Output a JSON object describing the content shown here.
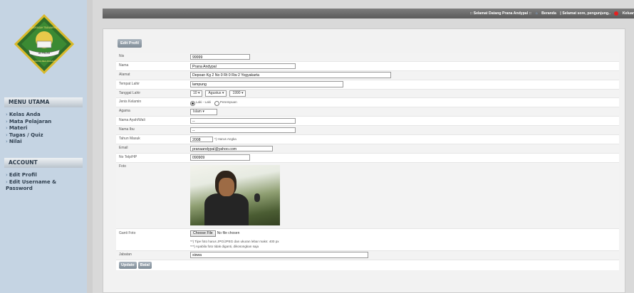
{
  "topbar": {
    "welcome": ":: Selamat Datang Prana Andypal ::",
    "home_label": "Beranda",
    "greeting": "| Selamat sore, pengunjung..",
    "logout_label": "Keluar"
  },
  "logo": {
    "banner_text": "MADRASAH TSANAWIYAH",
    "ribbon_text": "AL-FALAH",
    "bottom_text": "TANJUNG BELUNGKANG"
  },
  "sidebar": {
    "menu_title": "MENU UTAMA",
    "menu_items": [
      "Kelas Anda",
      "Mata Pelajaran",
      "Materi",
      "Tugas / Quiz",
      "Nilai"
    ],
    "account_title": "ACCOUNT",
    "account_items": [
      "Edit Profil",
      "Edit Username & Password"
    ]
  },
  "page": {
    "title": "Edit Profil"
  },
  "form": {
    "nis": {
      "label": "Nis",
      "value": "99999"
    },
    "nama": {
      "label": "Nama",
      "value": "Prana Andypal"
    },
    "alamat": {
      "label": "Alamat",
      "value": "Depoan Kg 2 No 0 Rt 0 Rw 2 Yogyakarta"
    },
    "tempat_lahir": {
      "label": "Tempat Lahir",
      "value": "lampung"
    },
    "tanggal_lahir": {
      "label": "Tanggal Lahir",
      "day": "10",
      "month": "Agustus",
      "year": "1990"
    },
    "jenis_kelamin": {
      "label": "Jenis Kelamin",
      "opt1": "Laki - Laki",
      "opt2": "Perempuan",
      "selected": "Laki - Laki"
    },
    "agama": {
      "label": "Agama",
      "value": "Islam"
    },
    "nama_ayah": {
      "label": "Nama Ayah/Wali",
      "value": "--"
    },
    "nama_ibu": {
      "label": "Nama Ibu",
      "value": "--"
    },
    "tahun_masuk": {
      "label": "Tahun Masuk",
      "value": "2008",
      "hint": "*) Harus Angka"
    },
    "email": {
      "label": "Email",
      "value": "pranaandypal@yahoo.com"
    },
    "telp": {
      "label": "No Telp/HP",
      "value": "090909"
    },
    "foto": {
      "label": "Foto"
    },
    "ganti_foto": {
      "label": "Ganti Foto",
      "button": "Choose File",
      "status": "No file chosen",
      "note1": "**) Tipe foto harus JPG/JPEG dan ukuran lebar maks: 400 px",
      "note2": "***) Apabila foto tidak diganti, dikosongkan saja"
    },
    "jabatan": {
      "label": "Jabatan",
      "value": "siswa"
    }
  },
  "actions": {
    "update": "Update",
    "cancel": "Batal"
  },
  "colors": {
    "sidebar_bg": "#c5d4e3",
    "button_bg": "#8a96a1",
    "topbar_bg": "#6b6b6b"
  }
}
